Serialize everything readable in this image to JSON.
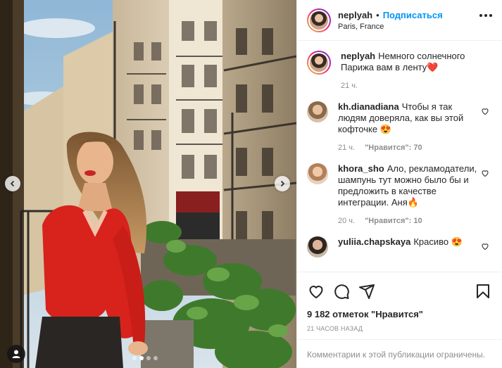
{
  "post": {
    "username": "neplyah",
    "follow_label": "Подписаться",
    "separator": "•",
    "location": "Paris, France"
  },
  "caption": {
    "username": "neplyah",
    "text": "Немного солнечного Парижа вам в ленту❤️",
    "time": "21 ч."
  },
  "comments": [
    {
      "username": "kh.dianadiana",
      "text": "Чтобы я так людям доверяла, как вы этой кофточке 😍",
      "time": "21 ч.",
      "likes": "\"Нравится\": 70"
    },
    {
      "username": "khora_sho",
      "text": "Ало, рекламодатели, шампунь тут можно было бы и предложить в качестве интеграции. Аня🔥",
      "time": "20 ч.",
      "likes": "\"Нравится\": 10"
    },
    {
      "username": "yuliia.chapskaya",
      "text": "Красиво 😍",
      "time": "",
      "likes": ""
    }
  ],
  "stats": {
    "likes": "9 182 отметок \"Нравится\"",
    "posted": "21 часов назад"
  },
  "footer": {
    "comments_closed": "Комментарии к этой публикации ограничены."
  },
  "carousel": {
    "count": 4,
    "active_index": 1
  },
  "icons": {
    "heart": "heart-icon",
    "comment": "comment-icon",
    "share": "share-icon",
    "bookmark": "bookmark-icon",
    "more": "more-icon",
    "prev": "chevron-left-icon",
    "next": "chevron-right-icon",
    "tags": "user-tag-icon"
  },
  "colors": {
    "accent": "#0095f6",
    "text": "#262626",
    "muted": "#8e8e8e",
    "border": "#efefef"
  }
}
